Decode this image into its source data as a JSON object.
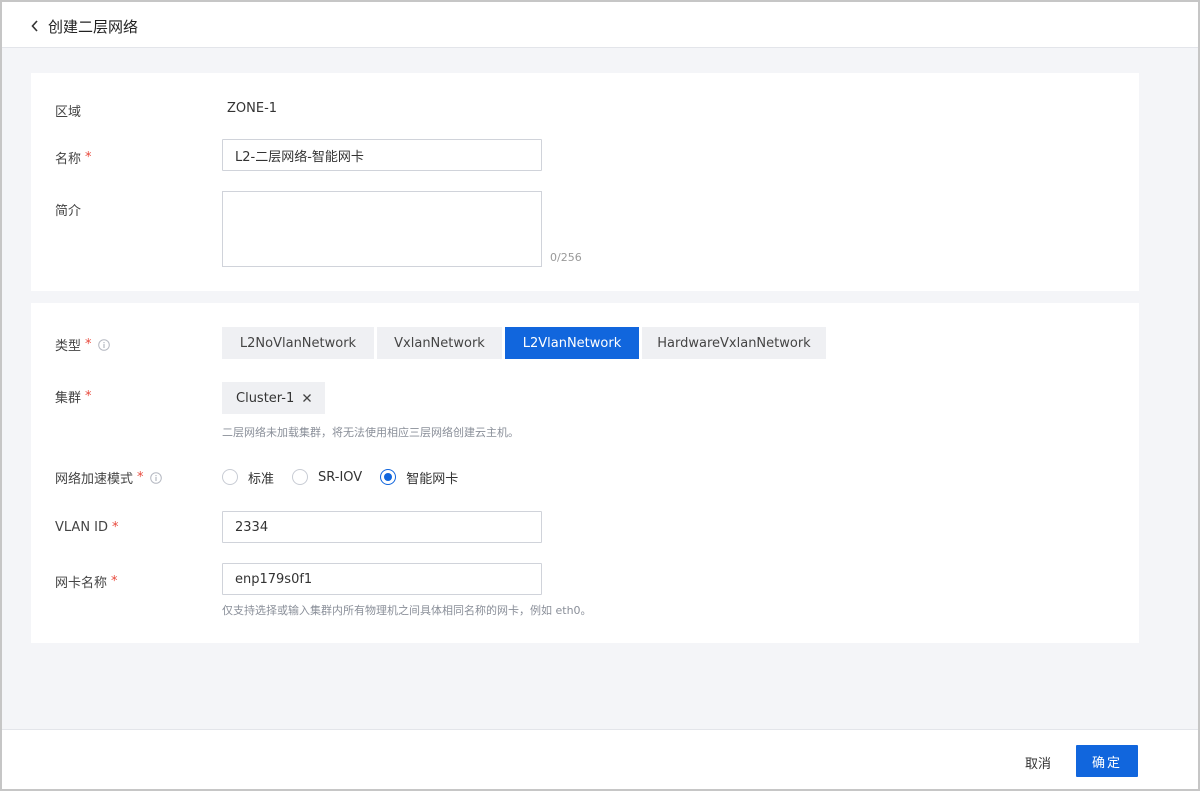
{
  "header": {
    "title": "创建二层网络"
  },
  "basic": {
    "zone_label": "区域",
    "zone_value": "ZONE-1",
    "name_label": "名称",
    "name_value": "L2-二层网络-智能网卡",
    "desc_label": "简介",
    "desc_value": "",
    "desc_counter": "0/256"
  },
  "network": {
    "type_label": "类型",
    "types": [
      {
        "label": "L2NoVlanNetwork",
        "active": false
      },
      {
        "label": "VxlanNetwork",
        "active": false
      },
      {
        "label": "L2VlanNetwork",
        "active": true
      },
      {
        "label": "HardwareVxlanNetwork",
        "active": false
      }
    ],
    "cluster_label": "集群",
    "cluster_tag": "Cluster-1",
    "cluster_hint": "二层网络未加载集群，将无法使用相应三层网络创建云主机。",
    "accel_label": "网络加速模式",
    "accel_options": [
      {
        "label": "标准",
        "checked": false
      },
      {
        "label": "SR-IOV",
        "checked": false
      },
      {
        "label": "智能网卡",
        "checked": true
      }
    ],
    "vlan_label": "VLAN ID",
    "vlan_value": "2334",
    "nic_label": "网卡名称",
    "nic_value": "enp179s0f1",
    "nic_hint": "仅支持选择或输入集群内所有物理机之间具体相同名称的网卡，例如 eth0。"
  },
  "footer": {
    "cancel_label": "取消",
    "ok_label": "确定"
  },
  "colors": {
    "accent": "#1166dd",
    "required": "#e8483b"
  }
}
